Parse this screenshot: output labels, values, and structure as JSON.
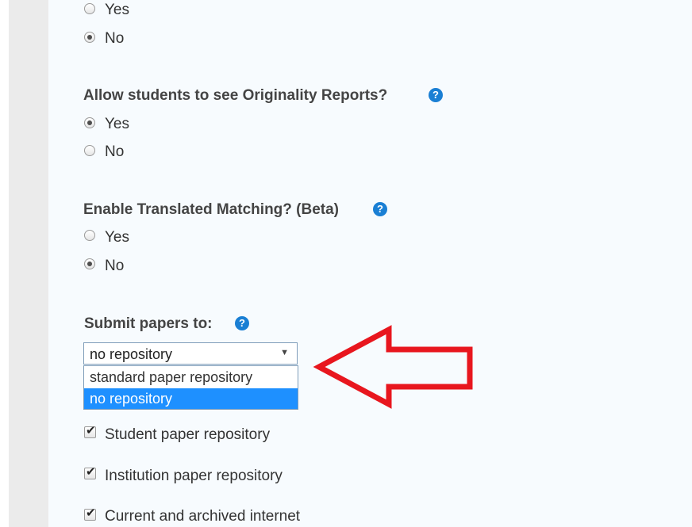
{
  "q_prev": {
    "options": [
      {
        "label": "Yes",
        "checked": false
      },
      {
        "label": "No",
        "checked": true
      }
    ]
  },
  "q_originality": {
    "question": "Allow students to see Originality Reports?",
    "help_icon": "?",
    "options": [
      {
        "label": "Yes",
        "checked": true
      },
      {
        "label": "No",
        "checked": false
      }
    ]
  },
  "q_translated": {
    "question": "Enable Translated Matching? (Beta)",
    "help_icon": "?",
    "options": [
      {
        "label": "Yes",
        "checked": false
      },
      {
        "label": "No",
        "checked": true
      }
    ]
  },
  "submit": {
    "question": "Submit papers to:",
    "help_icon": "?",
    "selected_value": "no repository",
    "caret": "▼",
    "dropdown_options": [
      {
        "label": "standard paper repository",
        "highlighted": false
      },
      {
        "label": "no repository",
        "highlighted": true
      }
    ]
  },
  "repositories": [
    {
      "label": "Student paper repository",
      "checked": true
    },
    {
      "label": "Institution paper repository",
      "checked": true
    },
    {
      "label": "Current and archived internet",
      "checked": true
    }
  ],
  "annotation": {
    "arrow_color": "#e8161e",
    "arrow_direction": "left"
  },
  "icons": {
    "help": "help-icon",
    "checkmark": "✔"
  }
}
